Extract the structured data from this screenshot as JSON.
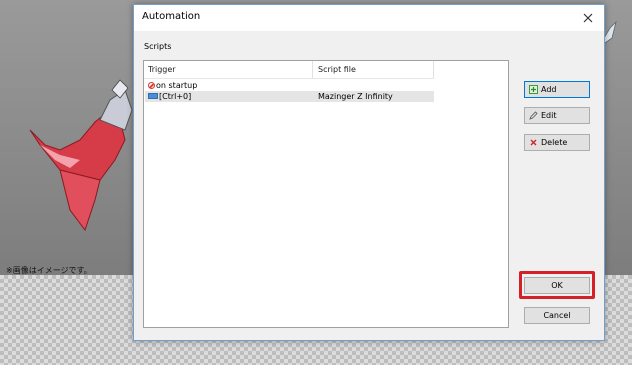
{
  "background": {
    "caption": "※画像はイメージです。"
  },
  "dialog": {
    "title": "Automation",
    "close_icon": "close-icon",
    "section_label": "Scripts",
    "columns": [
      "Trigger",
      "Script file"
    ],
    "rows": [
      {
        "icon": "forbidden-icon",
        "trigger": "on startup",
        "script": ""
      },
      {
        "icon": "keyboard-icon",
        "trigger": "[Ctrl+0]",
        "script": "Mazinger Z Infinity"
      }
    ],
    "buttons": {
      "add": "Add",
      "edit": "Edit",
      "delete": "Delete",
      "ok": "OK",
      "cancel": "Cancel"
    },
    "highlight_color": "#d42026",
    "accent_color": "#0078d7"
  }
}
